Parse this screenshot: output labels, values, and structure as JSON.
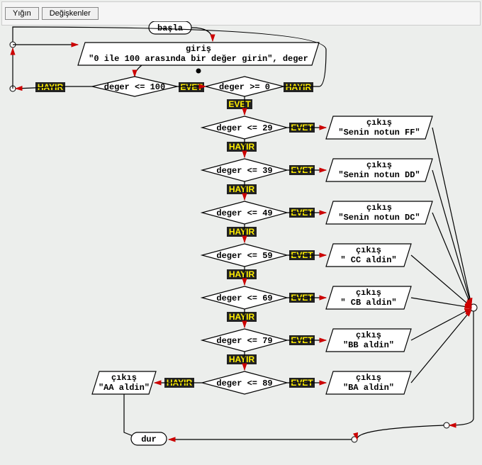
{
  "toolbar": {
    "stack": "Yığın",
    "vars": "Değişkenler"
  },
  "labels": {
    "evet": "EVET",
    "hayir": "HAYIR"
  },
  "nodes": {
    "start": "başla",
    "stop": "dur",
    "input_title": "giriş",
    "input_text": "\"0 ile 100 arasında bir değer girin\", deger",
    "d1": "deger <= 100",
    "d2": "deger >= 0",
    "d29": "deger <= 29",
    "d39": "deger <= 39",
    "d49": "deger <= 49",
    "d59": "deger <= 59",
    "d69": "deger <= 69",
    "d79": "deger <= 79",
    "d89": "deger <= 89",
    "out_title": "çıkış",
    "o29": "\"Senin notun FF\"",
    "o39": "\"Senin notun DD\"",
    "o49": "\"Senin notun DC\"",
    "o59": "\" CC aldin\"",
    "o69": "\" CB aldin\"",
    "o79": "\"BB aldin\"",
    "o89": "\"BA aldin\"",
    "oAA": "\"AA aldin\""
  }
}
